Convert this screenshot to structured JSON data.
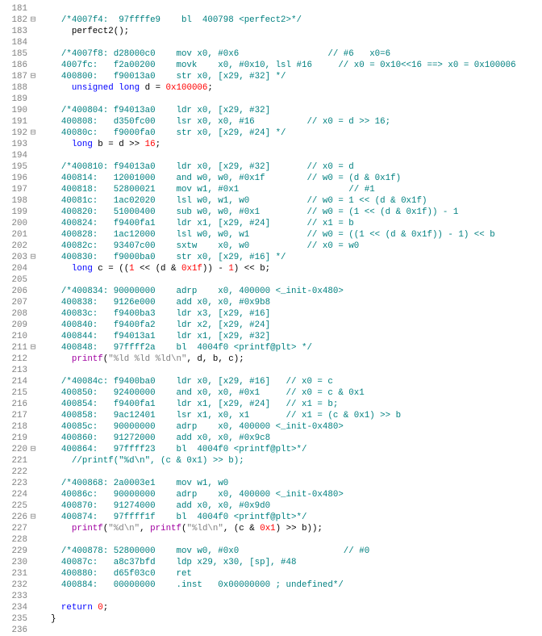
{
  "lines": [
    {
      "n": 181,
      "fold": "",
      "seg": [
        {
          "c": "",
          "t": ""
        }
      ]
    },
    {
      "n": 182,
      "fold": "⊟",
      "seg": [
        {
          "c": "",
          "t": "    "
        },
        {
          "c": "c-cmt",
          "t": "/*4007f4:  97ffffe9    bl  400798 <perfect2>*/"
        }
      ]
    },
    {
      "n": 183,
      "fold": "",
      "seg": [
        {
          "c": "",
          "t": "      perfect2();"
        }
      ]
    },
    {
      "n": 184,
      "fold": "",
      "seg": [
        {
          "c": "",
          "t": ""
        }
      ]
    },
    {
      "n": 185,
      "fold": "",
      "seg": [
        {
          "c": "",
          "t": "    "
        },
        {
          "c": "c-cmt",
          "t": "/*4007f8: d28000c0    mov x0, #0x6                 // #6   x0=6"
        }
      ]
    },
    {
      "n": 186,
      "fold": "",
      "seg": [
        {
          "c": "",
          "t": "    "
        },
        {
          "c": "c-cmt",
          "t": "4007fc:   f2a00200    movk    x0, #0x10, lsl #16     // x0 = 0x10<<16 ==> x0 = 0x100006"
        }
      ]
    },
    {
      "n": 187,
      "fold": "⊟",
      "seg": [
        {
          "c": "",
          "t": "    "
        },
        {
          "c": "c-cmt",
          "t": "400800:   f90013a0    str x0, [x29, #32] */"
        }
      ]
    },
    {
      "n": 188,
      "fold": "",
      "seg": [
        {
          "c": "",
          "t": "      "
        },
        {
          "c": "c-kw",
          "t": "unsigned"
        },
        {
          "c": "",
          "t": " "
        },
        {
          "c": "c-kw",
          "t": "long"
        },
        {
          "c": "",
          "t": " d = "
        },
        {
          "c": "c-num",
          "t": "0x100006"
        },
        {
          "c": "",
          "t": ";"
        }
      ]
    },
    {
      "n": 189,
      "fold": "",
      "seg": [
        {
          "c": "",
          "t": ""
        }
      ]
    },
    {
      "n": 190,
      "fold": "",
      "seg": [
        {
          "c": "",
          "t": "    "
        },
        {
          "c": "c-cmt",
          "t": "/*400804: f94013a0    ldr x0, [x29, #32]"
        }
      ]
    },
    {
      "n": 191,
      "fold": "",
      "seg": [
        {
          "c": "",
          "t": "    "
        },
        {
          "c": "c-cmt",
          "t": "400808:   d350fc00    lsr x0, x0, #16          // x0 = d >> 16;"
        }
      ]
    },
    {
      "n": 192,
      "fold": "⊟",
      "seg": [
        {
          "c": "",
          "t": "    "
        },
        {
          "c": "c-cmt",
          "t": "40080c:   f9000fa0    str x0, [x29, #24] */"
        }
      ]
    },
    {
      "n": 193,
      "fold": "",
      "seg": [
        {
          "c": "",
          "t": "      "
        },
        {
          "c": "c-kw",
          "t": "long"
        },
        {
          "c": "",
          "t": " b = d >> "
        },
        {
          "c": "c-num",
          "t": "16"
        },
        {
          "c": "",
          "t": ";"
        }
      ]
    },
    {
      "n": 194,
      "fold": "",
      "seg": [
        {
          "c": "",
          "t": ""
        }
      ]
    },
    {
      "n": 195,
      "fold": "",
      "seg": [
        {
          "c": "",
          "t": "    "
        },
        {
          "c": "c-cmt",
          "t": "/*400810: f94013a0    ldr x0, [x29, #32]       // x0 = d"
        }
      ]
    },
    {
      "n": 196,
      "fold": "",
      "seg": [
        {
          "c": "",
          "t": "    "
        },
        {
          "c": "c-cmt",
          "t": "400814:   12001000    and w0, w0, #0x1f        // w0 = (d & 0x1f)"
        }
      ]
    },
    {
      "n": 197,
      "fold": "",
      "seg": [
        {
          "c": "",
          "t": "    "
        },
        {
          "c": "c-cmt",
          "t": "400818:   52800021    mov w1, #0x1                     // #1"
        }
      ]
    },
    {
      "n": 198,
      "fold": "",
      "seg": [
        {
          "c": "",
          "t": "    "
        },
        {
          "c": "c-cmt",
          "t": "40081c:   1ac02020    lsl w0, w1, w0           // w0 = 1 << (d & 0x1f)"
        }
      ]
    },
    {
      "n": 199,
      "fold": "",
      "seg": [
        {
          "c": "",
          "t": "    "
        },
        {
          "c": "c-cmt",
          "t": "400820:   51000400    sub w0, w0, #0x1         // w0 = (1 << (d & 0x1f)) - 1"
        }
      ]
    },
    {
      "n": 200,
      "fold": "",
      "seg": [
        {
          "c": "",
          "t": "    "
        },
        {
          "c": "c-cmt",
          "t": "400824:   f9400fa1    ldr x1, [x29, #24]       // x1 = b"
        }
      ]
    },
    {
      "n": 201,
      "fold": "",
      "seg": [
        {
          "c": "",
          "t": "    "
        },
        {
          "c": "c-cmt",
          "t": "400828:   1ac12000    lsl w0, w0, w1           // w0 = ((1 << (d & 0x1f)) - 1) << b"
        }
      ]
    },
    {
      "n": 202,
      "fold": "",
      "seg": [
        {
          "c": "",
          "t": "    "
        },
        {
          "c": "c-cmt",
          "t": "40082c:   93407c00    sxtw    x0, w0           // x0 = w0"
        }
      ]
    },
    {
      "n": 203,
      "fold": "⊟",
      "seg": [
        {
          "c": "",
          "t": "    "
        },
        {
          "c": "c-cmt",
          "t": "400830:   f9000ba0    str x0, [x29, #16] */"
        }
      ]
    },
    {
      "n": 204,
      "fold": "",
      "seg": [
        {
          "c": "",
          "t": "      "
        },
        {
          "c": "c-kw",
          "t": "long"
        },
        {
          "c": "",
          "t": " c = (("
        },
        {
          "c": "c-num",
          "t": "1"
        },
        {
          "c": "",
          "t": " << (d & "
        },
        {
          "c": "c-num",
          "t": "0x1f"
        },
        {
          "c": "",
          "t": ")) - "
        },
        {
          "c": "c-num",
          "t": "1"
        },
        {
          "c": "",
          "t": ") << b;"
        }
      ]
    },
    {
      "n": 205,
      "fold": "",
      "seg": [
        {
          "c": "",
          "t": ""
        }
      ]
    },
    {
      "n": 206,
      "fold": "",
      "seg": [
        {
          "c": "",
          "t": "    "
        },
        {
          "c": "c-cmt",
          "t": "/*400834: 90000000    adrp    x0, 400000 <_init-0x480>"
        }
      ]
    },
    {
      "n": 207,
      "fold": "",
      "seg": [
        {
          "c": "",
          "t": "    "
        },
        {
          "c": "c-cmt",
          "t": "400838:   9126e000    add x0, x0, #0x9b8"
        }
      ]
    },
    {
      "n": 208,
      "fold": "",
      "seg": [
        {
          "c": "",
          "t": "    "
        },
        {
          "c": "c-cmt",
          "t": "40083c:   f9400ba3    ldr x3, [x29, #16]"
        }
      ]
    },
    {
      "n": 209,
      "fold": "",
      "seg": [
        {
          "c": "",
          "t": "    "
        },
        {
          "c": "c-cmt",
          "t": "400840:   f9400fa2    ldr x2, [x29, #24]"
        }
      ]
    },
    {
      "n": 210,
      "fold": "",
      "seg": [
        {
          "c": "",
          "t": "    "
        },
        {
          "c": "c-cmt",
          "t": "400844:   f94013a1    ldr x1, [x29, #32]"
        }
      ]
    },
    {
      "n": 211,
      "fold": "⊟",
      "seg": [
        {
          "c": "",
          "t": "    "
        },
        {
          "c": "c-cmt",
          "t": "400848:   97ffff2a    bl  4004f0 <printf@plt> */"
        }
      ]
    },
    {
      "n": 212,
      "fold": "",
      "seg": [
        {
          "c": "",
          "t": "      "
        },
        {
          "c": "c-pp",
          "t": "printf"
        },
        {
          "c": "",
          "t": "("
        },
        {
          "c": "c-str",
          "t": "\"%ld %ld %ld\\n\""
        },
        {
          "c": "",
          "t": ", d, b, c);"
        }
      ]
    },
    {
      "n": 213,
      "fold": "",
      "seg": [
        {
          "c": "",
          "t": ""
        }
      ]
    },
    {
      "n": 214,
      "fold": "",
      "seg": [
        {
          "c": "",
          "t": "    "
        },
        {
          "c": "c-cmt",
          "t": "/*40084c: f9400ba0    ldr x0, [x29, #16]   // x0 = c"
        }
      ]
    },
    {
      "n": 215,
      "fold": "",
      "seg": [
        {
          "c": "",
          "t": "    "
        },
        {
          "c": "c-cmt",
          "t": "400850:   92400000    and x0, x0, #0x1     // x0 = c & 0x1"
        }
      ]
    },
    {
      "n": 216,
      "fold": "",
      "seg": [
        {
          "c": "",
          "t": "    "
        },
        {
          "c": "c-cmt",
          "t": "400854:   f9400fa1    ldr x1, [x29, #24]   // x1 = b;"
        }
      ]
    },
    {
      "n": 217,
      "fold": "",
      "seg": [
        {
          "c": "",
          "t": "    "
        },
        {
          "c": "c-cmt",
          "t": "400858:   9ac12401    lsr x1, x0, x1       // x1 = (c & 0x1) >> b"
        }
      ]
    },
    {
      "n": 218,
      "fold": "",
      "seg": [
        {
          "c": "",
          "t": "    "
        },
        {
          "c": "c-cmt",
          "t": "40085c:   90000000    adrp    x0, 400000 <_init-0x480>"
        }
      ]
    },
    {
      "n": 219,
      "fold": "",
      "seg": [
        {
          "c": "",
          "t": "    "
        },
        {
          "c": "c-cmt",
          "t": "400860:   91272000    add x0, x0, #0x9c8"
        }
      ]
    },
    {
      "n": 220,
      "fold": "⊟",
      "seg": [
        {
          "c": "",
          "t": "    "
        },
        {
          "c": "c-cmt",
          "t": "400864:   97ffff23    bl  4004f0 <printf@plt>*/"
        }
      ]
    },
    {
      "n": 221,
      "fold": "",
      "seg": [
        {
          "c": "",
          "t": "      "
        },
        {
          "c": "c-cmt",
          "t": "//printf(\"%d\\n\", (c & 0x1) >> b);"
        }
      ]
    },
    {
      "n": 222,
      "fold": "",
      "seg": [
        {
          "c": "",
          "t": ""
        }
      ]
    },
    {
      "n": 223,
      "fold": "",
      "seg": [
        {
          "c": "",
          "t": "    "
        },
        {
          "c": "c-cmt",
          "t": "/*400868: 2a0003e1    mov w1, w0"
        }
      ]
    },
    {
      "n": 224,
      "fold": "",
      "seg": [
        {
          "c": "",
          "t": "    "
        },
        {
          "c": "c-cmt",
          "t": "40086c:   90000000    adrp    x0, 400000 <_init-0x480>"
        }
      ]
    },
    {
      "n": 225,
      "fold": "",
      "seg": [
        {
          "c": "",
          "t": "    "
        },
        {
          "c": "c-cmt",
          "t": "400870:   91274000    add x0, x0, #0x9d0"
        }
      ]
    },
    {
      "n": 226,
      "fold": "⊟",
      "seg": [
        {
          "c": "",
          "t": "    "
        },
        {
          "c": "c-cmt",
          "t": "400874:   97ffff1f    bl  4004f0 <printf@plt>*/"
        }
      ]
    },
    {
      "n": 227,
      "fold": "",
      "seg": [
        {
          "c": "",
          "t": "      "
        },
        {
          "c": "c-pp",
          "t": "printf"
        },
        {
          "c": "",
          "t": "("
        },
        {
          "c": "c-str",
          "t": "\"%d\\n\""
        },
        {
          "c": "",
          "t": ", "
        },
        {
          "c": "c-pp",
          "t": "printf"
        },
        {
          "c": "",
          "t": "("
        },
        {
          "c": "c-str",
          "t": "\"%ld\\n\""
        },
        {
          "c": "",
          "t": ", (c & "
        },
        {
          "c": "c-num",
          "t": "0x1"
        },
        {
          "c": "",
          "t": ") >> b));"
        }
      ]
    },
    {
      "n": 228,
      "fold": "",
      "seg": [
        {
          "c": "",
          "t": ""
        }
      ]
    },
    {
      "n": 229,
      "fold": "",
      "seg": [
        {
          "c": "",
          "t": "    "
        },
        {
          "c": "c-cmt",
          "t": "/*400878: 52800000    mov w0, #0x0                    // #0"
        }
      ]
    },
    {
      "n": 230,
      "fold": "",
      "seg": [
        {
          "c": "",
          "t": "    "
        },
        {
          "c": "c-cmt",
          "t": "40087c:   a8c37bfd    ldp x29, x30, [sp], #48"
        }
      ]
    },
    {
      "n": 231,
      "fold": "",
      "seg": [
        {
          "c": "",
          "t": "    "
        },
        {
          "c": "c-cmt",
          "t": "400880:   d65f03c0    ret"
        }
      ]
    },
    {
      "n": 232,
      "fold": "",
      "seg": [
        {
          "c": "",
          "t": "    "
        },
        {
          "c": "c-cmt",
          "t": "400884:   00000000    .inst   0x00000000 ; undefined*/"
        }
      ]
    },
    {
      "n": 233,
      "fold": "",
      "seg": [
        {
          "c": "",
          "t": ""
        }
      ]
    },
    {
      "n": 234,
      "fold": "",
      "seg": [
        {
          "c": "",
          "t": "    "
        },
        {
          "c": "c-kw",
          "t": "return"
        },
        {
          "c": "",
          "t": " "
        },
        {
          "c": "c-num",
          "t": "0"
        },
        {
          "c": "",
          "t": ";"
        }
      ]
    },
    {
      "n": 235,
      "fold": "",
      "seg": [
        {
          "c": "",
          "t": "  }"
        }
      ]
    },
    {
      "n": 236,
      "fold": "",
      "seg": [
        {
          "c": "",
          "t": ""
        }
      ]
    }
  ]
}
